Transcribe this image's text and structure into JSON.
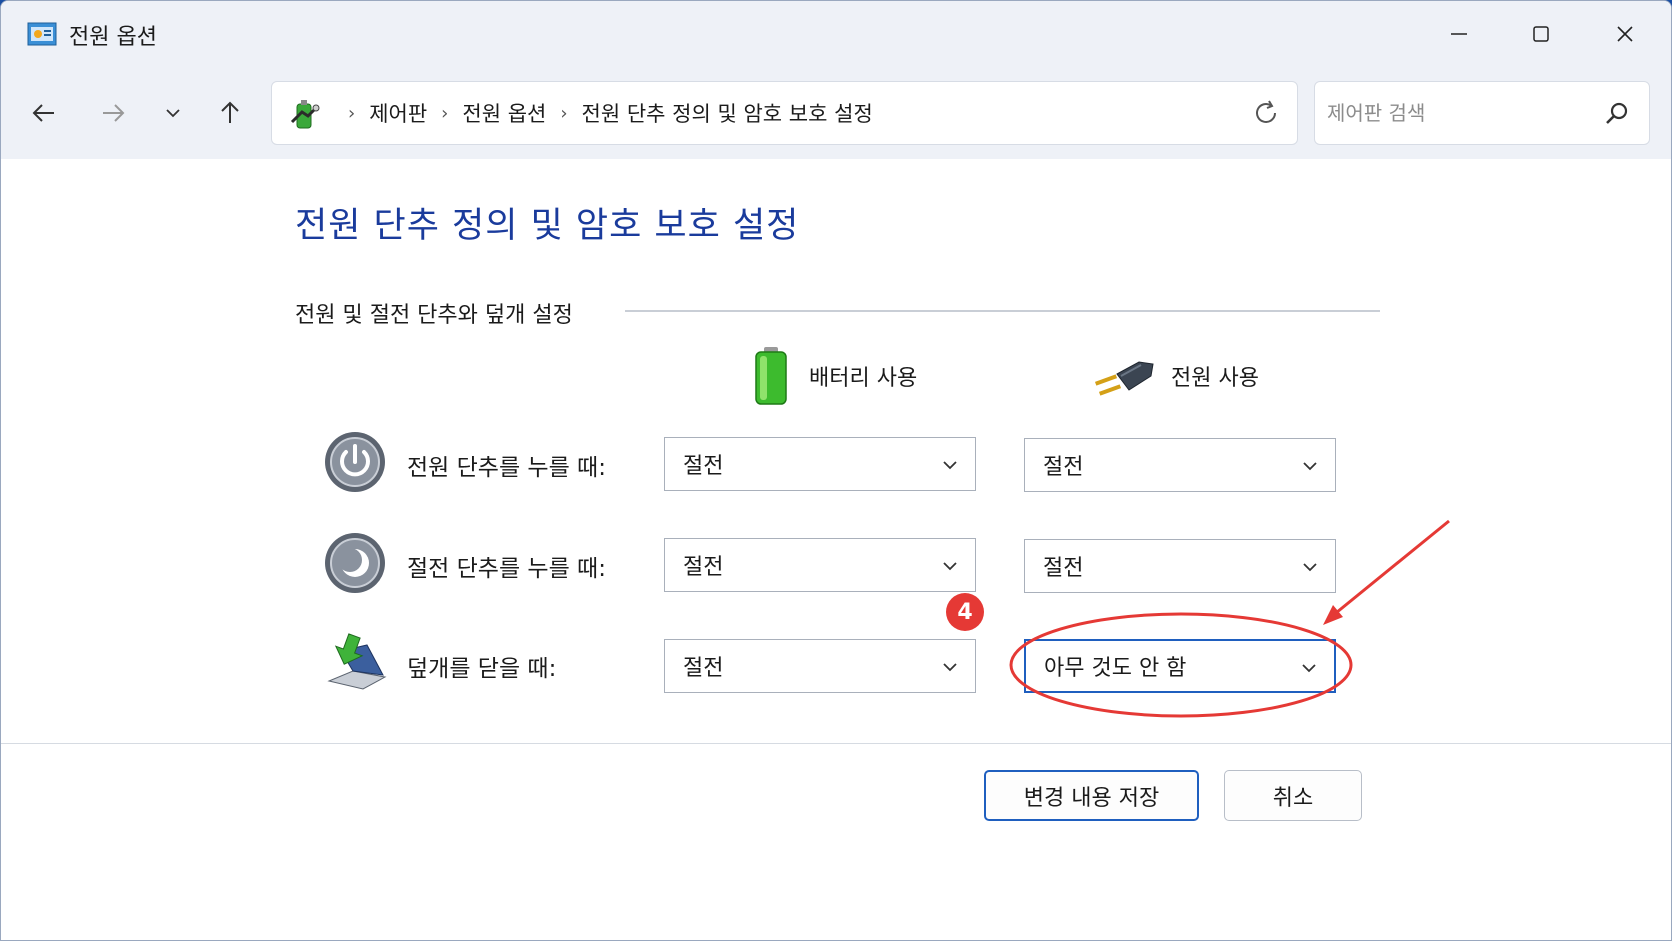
{
  "window": {
    "title": "전원 옵션",
    "icon": "power-options-icon",
    "controls": [
      "minimize-icon",
      "maximize-icon",
      "close-icon"
    ]
  },
  "navigation": {
    "back": "back-arrow-icon",
    "forward": "forward-arrow-icon",
    "recent": "chevron-down-icon",
    "up": "up-arrow-icon"
  },
  "address": {
    "crumbs": [
      "제어판",
      "전원 옵션",
      "전원 단추 정의 및 암호 보호 설정"
    ],
    "refresh": "refresh-icon"
  },
  "search": {
    "placeholder": "제어판 검색"
  },
  "page": {
    "title": "전원 단추 정의 및 암호 보호 설정",
    "section_title": "전원 및 절전 단추와 덮개 설정",
    "columns": {
      "battery": "배터리 사용",
      "plugged": "전원 사용"
    },
    "rows": [
      {
        "label": "전원 단추를 누를 때:",
        "battery": "절전",
        "plugged": "절전",
        "icon": "power-button-icon"
      },
      {
        "label": "절전 단추를 누를 때:",
        "battery": "절전",
        "plugged": "절전",
        "icon": "sleep-button-icon"
      },
      {
        "label": "덮개를 닫을 때:",
        "battery": "절전",
        "plugged": "아무 것도 안 함",
        "icon": "lid-close-icon"
      }
    ]
  },
  "footer": {
    "save": "변경 내용 저장",
    "cancel": "취소"
  },
  "annotation": {
    "badge": "4",
    "color": "#e53935"
  },
  "colors": {
    "title": "#1a3b9c",
    "accent": "#1f5fbf"
  }
}
